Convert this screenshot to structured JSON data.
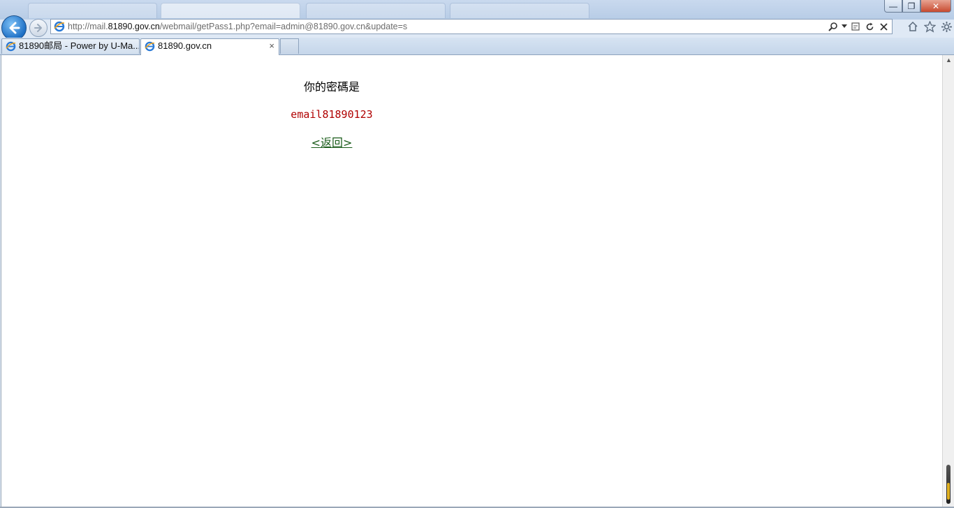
{
  "window": {
    "minimize_symbol": "—",
    "restore_symbol": "❐",
    "close_symbol": "✕"
  },
  "address_bar": {
    "url_prefix": "http://mail.",
    "url_domain": "81890.gov.cn",
    "url_path": "/webmail/getPass1.php?email=admin@81890.gov.cn&update=s"
  },
  "tabs": [
    {
      "label": "81890邮局 - Power by U-Ma...",
      "active": false
    },
    {
      "label": "81890.gov.cn",
      "active": true,
      "close": "×"
    }
  ],
  "page": {
    "message": "你的密碼是",
    "password": "email81890123",
    "back_link": "<返回>"
  },
  "colors": {
    "password_text": "#b00000",
    "link_text": "#1a5c1a"
  }
}
